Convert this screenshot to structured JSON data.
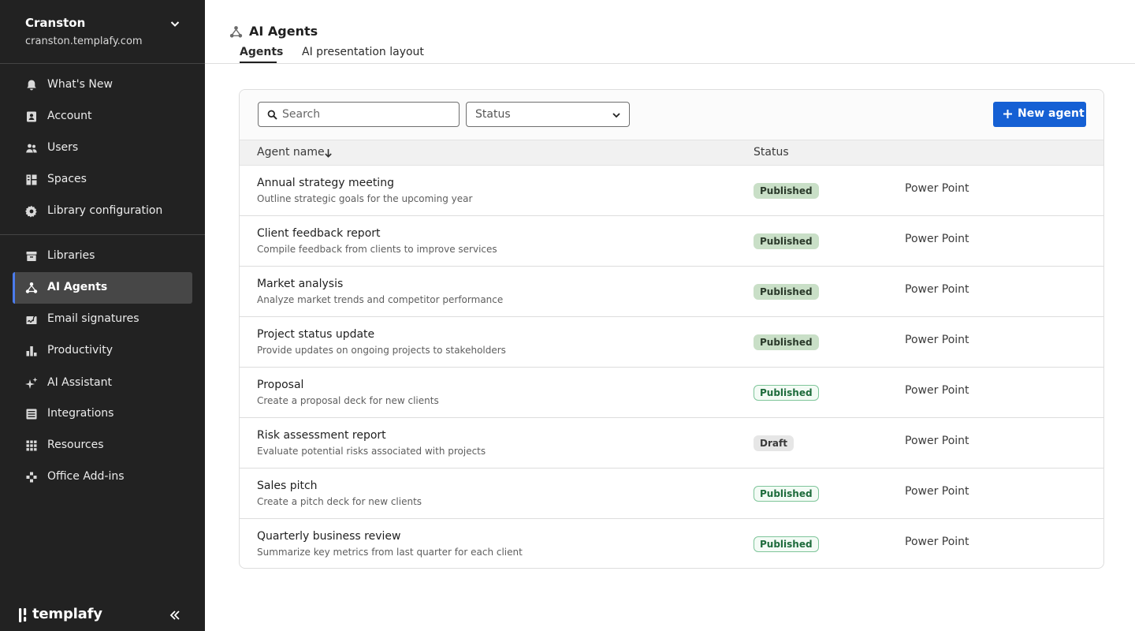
{
  "sidebar": {
    "org_name": "Cranston",
    "org_domain": "cranston.templafy.com",
    "primary_items": [
      {
        "label": "What's New",
        "icon": "bell-icon"
      },
      {
        "label": "Account",
        "icon": "account-icon"
      },
      {
        "label": "Users",
        "icon": "users-icon"
      },
      {
        "label": "Spaces",
        "icon": "spaces-icon"
      },
      {
        "label": "Library configuration",
        "icon": "gear-icon"
      }
    ],
    "secondary_items": [
      {
        "label": "Libraries",
        "icon": "libraries-icon"
      },
      {
        "label": "AI Agents",
        "icon": "ai-agents-icon",
        "active": true
      },
      {
        "label": "Email signatures",
        "icon": "email-signature-icon"
      },
      {
        "label": "Productivity",
        "icon": "productivity-icon"
      },
      {
        "label": "AI Assistant",
        "icon": "sparkle-icon"
      },
      {
        "label": "Integrations",
        "icon": "integrations-icon"
      },
      {
        "label": "Resources",
        "icon": "grid-icon"
      },
      {
        "label": "Office Add-ins",
        "icon": "add-ins-icon"
      }
    ],
    "brand": "templafy",
    "accent_color": "#4b7bec"
  },
  "header": {
    "title": "AI Agents",
    "tabs": [
      {
        "label": "Agents",
        "active": true
      },
      {
        "label": "AI presentation layout",
        "active": false
      }
    ]
  },
  "toolbar": {
    "search_placeholder": "Search",
    "status_filter_label": "Status",
    "new_agent_label": "New agent",
    "button_color": "#1560d4"
  },
  "table": {
    "columns": [
      "Agent name",
      "Status"
    ],
    "rows": [
      {
        "name": "Annual strategy meeting",
        "description": "Outline strategic goals for the upcoming year",
        "status": "Published",
        "status_style": "solid",
        "type": "Power Point"
      },
      {
        "name": "Client feedback report",
        "description": "Compile feedback from clients to improve services",
        "status": "Published",
        "status_style": "solid",
        "type": "Power Point"
      },
      {
        "name": "Market analysis",
        "description": "Analyze market trends and competitor performance",
        "status": "Published",
        "status_style": "solid",
        "type": "Power Point"
      },
      {
        "name": "Project status update",
        "description": "Provide updates on ongoing projects to stakeholders",
        "status": "Published",
        "status_style": "solid",
        "type": "Power Point"
      },
      {
        "name": "Proposal",
        "description": "Create a proposal deck for new clients",
        "status": "Published",
        "status_style": "outline",
        "type": "Power Point"
      },
      {
        "name": "Risk assessment report",
        "description": "Evaluate potential risks associated with projects",
        "status": "Draft",
        "status_style": "draft",
        "type": "Power Point"
      },
      {
        "name": "Sales pitch",
        "description": "Create a pitch deck for new clients",
        "status": "Published",
        "status_style": "outline",
        "type": "Power Point"
      },
      {
        "name": "Quarterly business review",
        "description": "Summarize key metrics from last quarter for each client",
        "status": "Published",
        "status_style": "outline",
        "type": "Power Point"
      }
    ]
  }
}
